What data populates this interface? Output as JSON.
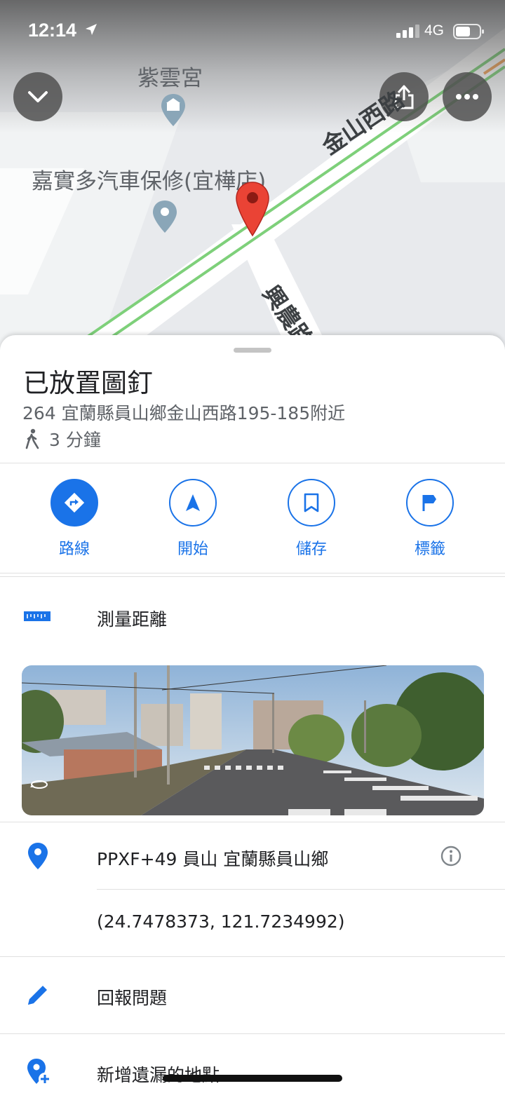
{
  "status_bar": {
    "time": "12:14",
    "network": "4G"
  },
  "map": {
    "labels": {
      "temple": "紫雲宮",
      "shop": "嘉實多汽車保修(宜樺店)",
      "road_main": "金山西路",
      "road_side": "興農路"
    },
    "pin_color": "#ea4335"
  },
  "place": {
    "title": "已放置圖釘",
    "address": "264 宜蘭縣員山鄉金山西路195-185附近",
    "walk_time": "3 分鐘"
  },
  "actions": [
    {
      "label": "路線",
      "icon": "directions-icon"
    },
    {
      "label": "開始",
      "icon": "navigation-icon"
    },
    {
      "label": "儲存",
      "icon": "bookmark-icon"
    },
    {
      "label": "標籤",
      "icon": "flag-icon"
    }
  ],
  "measure": {
    "label": "測量距離"
  },
  "details": {
    "plus_code": "PPXF+49 員山 宜蘭縣員山鄉",
    "coordinates": "(24.7478373, 121.7234992)"
  },
  "report": {
    "label": "回報問題"
  },
  "add_place": {
    "label": "新增遺漏的地點"
  },
  "colors": {
    "accent": "#1a73e8",
    "pin": "#ea4335",
    "route": "#7ed07a"
  }
}
